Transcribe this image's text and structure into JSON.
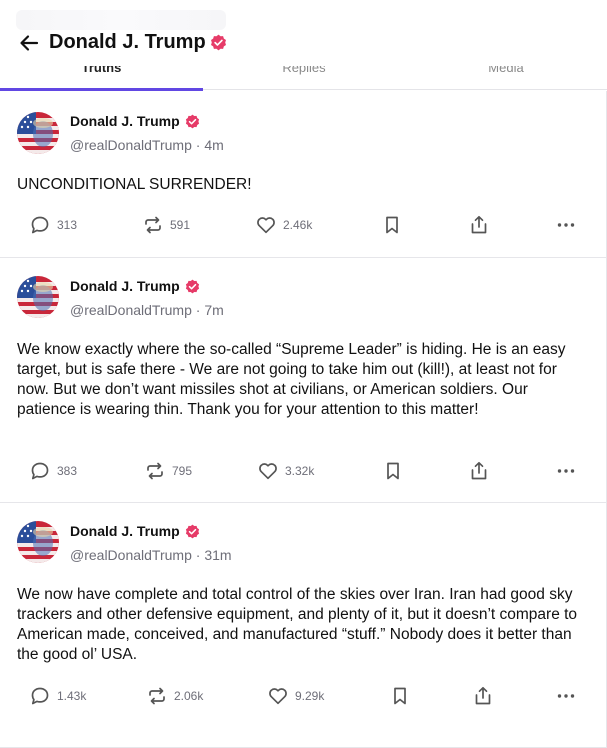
{
  "header": {
    "title": "Donald J. Trump",
    "verified": true
  },
  "tabs": [
    {
      "label": "Truths",
      "active": true
    },
    {
      "label": "Replies",
      "active": false
    },
    {
      "label": "Media",
      "active": false
    }
  ],
  "posts": [
    {
      "author": "Donald J. Trump",
      "handle": "@realDonaldTrump",
      "time": "4m",
      "text": "UNCONDITIONAL SURRENDER!",
      "replies": "313",
      "retruths": "591",
      "likes": "2.46k"
    },
    {
      "author": "Donald J. Trump",
      "handle": "@realDonaldTrump",
      "time": "7m",
      "text": "We know exactly where the so-called “Supreme Leader” is hiding. He is an easy target, but is safe there - We are not going to take him out (kill!), at least not for now. But we don’t want missiles shot at civilians, or American soldiers. Our patience is wearing thin. Thank you for your attention to this matter!",
      "replies": "383",
      "retruths": "795",
      "likes": "3.32k"
    },
    {
      "author": "Donald J. Trump",
      "handle": "@realDonaldTrump",
      "time": "31m",
      "text": "We now have complete and total control of the skies over Iran. Iran had good sky trackers and other defensive equipment, and plenty of it, but it doesn’t compare to American made, conceived, and manufactured “stuff.” Nobody does it better than the good ol’ USA.",
      "replies": "1.43k",
      "retruths": "2.06k",
      "likes": "9.29k"
    }
  ],
  "colors": {
    "accent": "#6147e3",
    "verified_badge": "#e63b68",
    "muted_text": "#6e6e78"
  },
  "icons": [
    "back-arrow-icon",
    "verified-badge-icon",
    "reply-icon",
    "retruth-icon",
    "heart-icon",
    "bookmark-icon",
    "share-icon",
    "more-icon"
  ]
}
